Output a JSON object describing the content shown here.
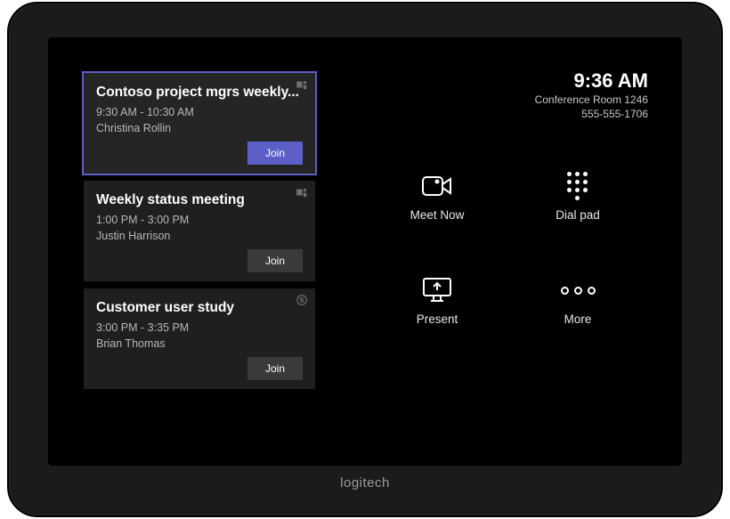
{
  "brand": "logitech",
  "clock": {
    "time": "9:36 AM",
    "room": "Conference Room 1246",
    "phone": "555-555-1706"
  },
  "meetings": [
    {
      "title": "Contoso project mgrs weekly...",
      "time": "9:30 AM - 10:30 AM",
      "organizer": "Christina Rollin",
      "join_label": "Join",
      "active": true,
      "badge": "teams"
    },
    {
      "title": "Weekly status meeting",
      "time": "1:00 PM - 3:00 PM",
      "organizer": "Justin Harrison",
      "join_label": "Join",
      "active": false,
      "badge": "teams"
    },
    {
      "title": "Customer user study",
      "time": "3:00 PM - 3:35 PM",
      "organizer": "Brian Thomas",
      "join_label": "Join",
      "active": false,
      "badge": "skype"
    }
  ],
  "actions": {
    "meet_now": "Meet Now",
    "dial_pad": "Dial pad",
    "present": "Present",
    "more": "More"
  }
}
